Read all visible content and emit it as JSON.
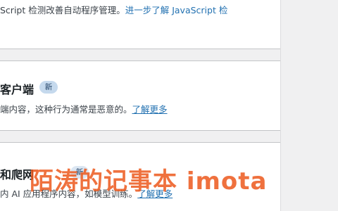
{
  "sections": {
    "top": {
      "desc_prefix": "Script 检测改善自动程序管理。",
      "link": "进一步了解 JavaScript 检"
    },
    "client": {
      "title": "客户端",
      "badge": "新",
      "desc_prefix": "端内容，这种行为通常是恶意的。",
      "link": "了解更多"
    },
    "crawler": {
      "title": "和爬网",
      "badge": "新",
      "desc_prefix": "内 AI 应用程序内容，如模型训练。",
      "link": "了解更多"
    }
  },
  "watermark": "陌涛的记事本 imota"
}
